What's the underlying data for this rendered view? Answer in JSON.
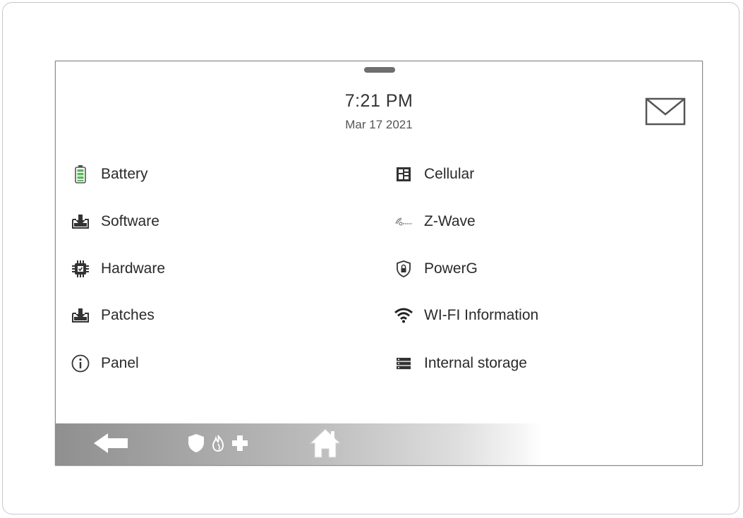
{
  "status": {
    "time": "7:21 PM",
    "date": "Mar 17 2021"
  },
  "icons": {
    "mail": "envelope-icon",
    "battery": "battery-icon",
    "software": "download-tray-icon",
    "hardware": "chip-icon",
    "patches": "download-tray-icon",
    "panel": "info-icon",
    "cellular": "cellular-module-icon",
    "zwave": "zwave-icon",
    "powerg": "shield-lock-icon",
    "wifi": "wifi-icon",
    "storage": "storage-icon"
  },
  "menu": {
    "left": [
      {
        "label": "Battery"
      },
      {
        "label": "Software"
      },
      {
        "label": "Hardware"
      },
      {
        "label": "Patches"
      },
      {
        "label": "Panel"
      }
    ],
    "right": [
      {
        "label": "Cellular"
      },
      {
        "label": "Z-Wave"
      },
      {
        "label": "PowerG"
      },
      {
        "label": "WI-FI Information"
      },
      {
        "label": "Internal storage"
      }
    ]
  },
  "navbar": {
    "buttons": [
      "back-arrow-icon",
      "shield-icon",
      "flame-icon",
      "medical-cross-icon",
      "home-icon"
    ]
  },
  "colors": {
    "battery_green": "#5cb85c",
    "text": "#2a2a2a",
    "navbar_dark": "#8f8f8f"
  }
}
